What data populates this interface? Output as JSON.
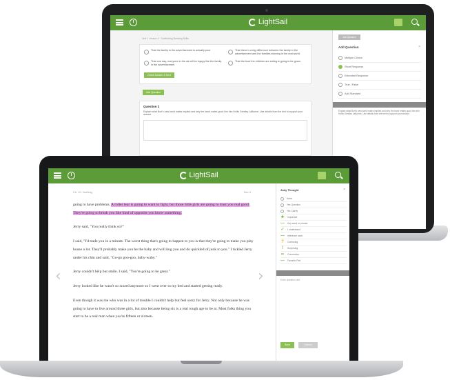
{
  "brand": {
    "name": "LightSail",
    "accent": "#5c9c38"
  },
  "back_screen": {
    "breadcrumb": "Unit 1 Lesson 4 · Scaffolding Reading Skills",
    "options": [
      "That the family in the advertisement is actually poor",
      "That there is a big difference between the family in the advertisement and the families starving in the real world",
      "That one day, everyone in the ad will be happy like the family in the advertisement",
      "That the food the children are eating is going to be gross"
    ],
    "check_answer_label": "Check Answer & Next",
    "add_question_label": "Add Question",
    "question2": {
      "title": "Question 2",
      "text": "Explain what Burt's new band mates implied and why the band mates good him into Hollis Greeley LaBonne. Use details from the text to support your answer."
    },
    "sidebar": {
      "tab_label": "Add Question",
      "title": "Add Question",
      "types": [
        "Multiple Choice",
        "Short Response",
        "Extended Response",
        "True / False",
        "Add Standard"
      ],
      "selected_index": 1,
      "body_text": "Explain what Burt's new band mates implied and why the band mates good him into Hollis Greeley LaBonne. Use details from the text to support your answer."
    }
  },
  "front_screen": {
    "breadcrumb": "Ch. 10: Nothing",
    "page_label": "Sec 3",
    "paragraphs": [
      {
        "before": "going to have problems. ",
        "highlight": "A roller tear is going to want to fight, but those little girls are going to trust you real good. They're going to break you like kind of opposite you know something.",
        "after": ""
      },
      {
        "before": "Jerry said, \"You really think so?\"",
        "highlight": "",
        "after": ""
      },
      {
        "before": "I said, \"I'd trade you in a minute. The worst thing that's going to happen to you is that they're going to make you play house a lot. They'll probably make you be the baby and will hug you and do quickled of junk to you.\" I tickled Jerry under his chin and said, \"Go-go goo-goo, baby-waby.\"",
        "highlight": "",
        "after": ""
      },
      {
        "before": "Jerry couldn't help but smile. I said, \"You're going to be great.\"",
        "highlight": "",
        "after": ""
      },
      {
        "before": "Jerry looked like he wasn't so scared anymore so I went over to my bed and started getting ready.",
        "highlight": "",
        "after": ""
      },
      {
        "before": "Even though it was me who was in a lot of trouble I couldn't help but feel sorry for Jerry. Not only because he was going to have to live around three girls, but also because being six is a real rough age to be at. Most folks thing you start to be a real man when you're fifteen or sixteen.",
        "highlight": "",
        "after": ""
      }
    ],
    "sidebar": {
      "title": "Jody Thought",
      "items": [
        {
          "kind": "dot",
          "label": "None"
        },
        {
          "kind": "dot",
          "label": "Yes Question"
        },
        {
          "kind": "dot",
          "label": "Yes Clarify"
        },
        {
          "kind": "star",
          "label": "Important"
        },
        {
          "kind": "line",
          "label": "Key word or phrase"
        },
        {
          "kind": "check",
          "label": "I understand"
        },
        {
          "kind": "line",
          "label": "Inference work"
        },
        {
          "kind": "q",
          "label": "Confusing"
        },
        {
          "kind": "s",
          "label": "Surprising"
        },
        {
          "kind": "oo",
          "label": "Connection"
        },
        {
          "kind": "line",
          "label": "Favorite Part"
        }
      ],
      "note_placeholder": "Enter question text",
      "save_label": "Save",
      "cancel_label": "Cancel"
    }
  }
}
